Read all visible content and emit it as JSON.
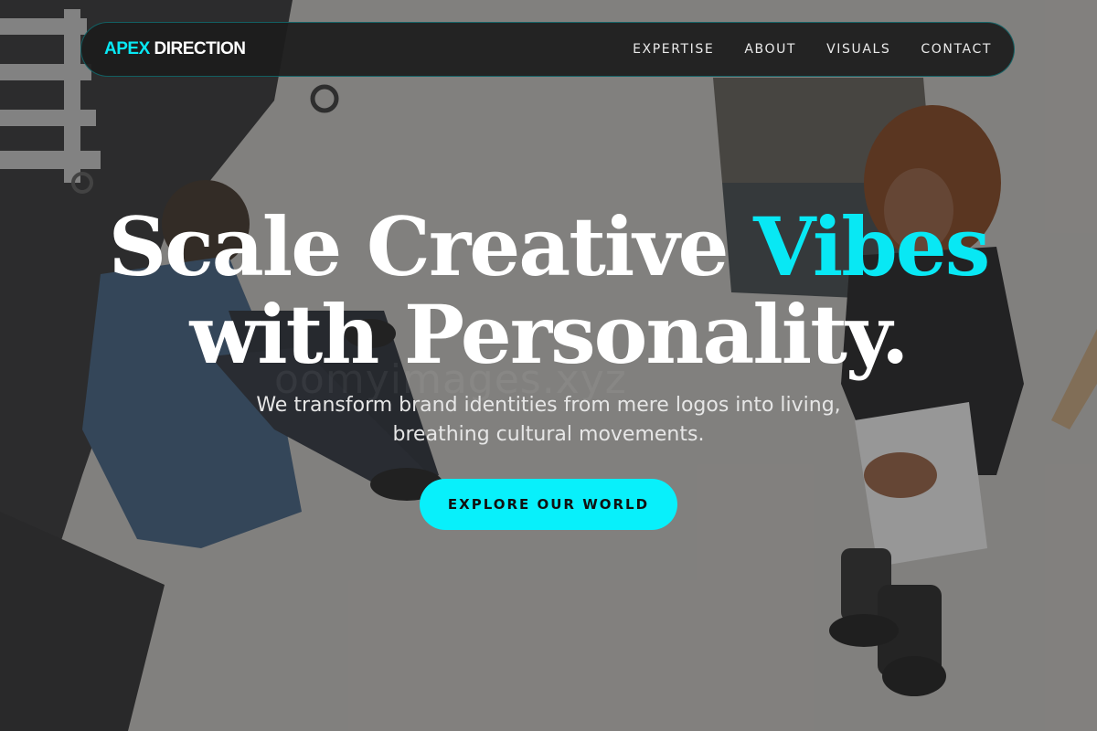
{
  "brand": {
    "accent_word": "APEX",
    "rest": "DIRECTION",
    "accent_color": "#08e8f4"
  },
  "nav": {
    "links": [
      "EXPERTISE",
      "ABOUT",
      "VISUALS",
      "CONTACT"
    ]
  },
  "hero": {
    "headline_part1": "Scale Creative ",
    "headline_accent": "Vibes",
    "headline_part2": "with Personality.",
    "subheadline_line1": "We transform brand identities from mere logos into living,",
    "subheadline_line2": "breathing cultural movements.",
    "cta_label": "EXPLORE OUR WORLD",
    "cta_color": "#08f0fb",
    "background_image": "photo-two-people-sitting-on-studio-floor"
  }
}
